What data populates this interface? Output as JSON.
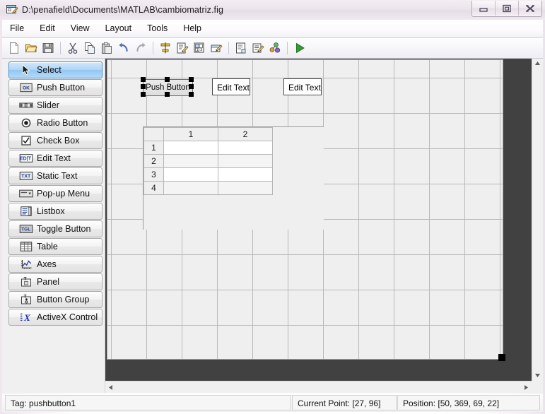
{
  "window": {
    "title": "D:\\penafield\\Documents\\MATLAB\\cambiomatriz.fig",
    "icon": "guide-figure-icon",
    "buttons": {
      "minimize": "minimize-button",
      "restore": "restore-button",
      "close": "close-button"
    }
  },
  "menu": {
    "items": [
      "File",
      "Edit",
      "View",
      "Layout",
      "Tools",
      "Help"
    ]
  },
  "toolbar": {
    "groups": [
      [
        {
          "name": "new-figure-icon",
          "tip": "New"
        },
        {
          "name": "open-file-icon",
          "tip": "Open"
        },
        {
          "name": "save-icon",
          "tip": "Save"
        }
      ],
      [
        {
          "name": "cut-icon",
          "tip": "Cut"
        },
        {
          "name": "copy-icon",
          "tip": "Copy"
        },
        {
          "name": "paste-icon",
          "tip": "Paste"
        },
        {
          "name": "undo-icon",
          "tip": "Undo"
        },
        {
          "name": "redo-icon",
          "tip": "Redo"
        }
      ],
      [
        {
          "name": "align-objects-icon",
          "tip": "Align Objects"
        },
        {
          "name": "menu-editor-icon",
          "tip": "Menu Editor"
        },
        {
          "name": "tab-order-editor-icon",
          "tip": "Tab Order Editor"
        },
        {
          "name": "toolbar-editor-icon",
          "tip": "Toolbar Editor"
        }
      ],
      [
        {
          "name": "m-file-editor-icon",
          "tip": "M-file Editor"
        },
        {
          "name": "property-inspector-icon",
          "tip": "Property Inspector"
        },
        {
          "name": "object-browser-icon",
          "tip": "Object Browser"
        }
      ],
      [
        {
          "name": "run-icon",
          "tip": "Run"
        }
      ]
    ]
  },
  "palette": {
    "items": [
      {
        "label": "Select",
        "icon": "cursor-arrow-icon",
        "selected": true
      },
      {
        "label": "Push Button",
        "icon": "push-button-icon",
        "selected": false
      },
      {
        "label": "Slider",
        "icon": "slider-icon",
        "selected": false
      },
      {
        "label": "Radio Button",
        "icon": "radio-button-icon",
        "selected": false
      },
      {
        "label": "Check Box",
        "icon": "check-box-icon",
        "selected": false
      },
      {
        "label": "Edit Text",
        "icon": "edit-text-icon",
        "selected": false
      },
      {
        "label": "Static Text",
        "icon": "static-text-icon",
        "selected": false
      },
      {
        "label": "Pop-up Menu",
        "icon": "popup-menu-icon",
        "selected": false
      },
      {
        "label": "Listbox",
        "icon": "listbox-icon",
        "selected": false
      },
      {
        "label": "Toggle Button",
        "icon": "toggle-button-icon",
        "selected": false
      },
      {
        "label": "Table",
        "icon": "table-icon",
        "selected": false
      },
      {
        "label": "Axes",
        "icon": "axes-icon",
        "selected": false
      },
      {
        "label": "Panel",
        "icon": "panel-icon",
        "selected": false
      },
      {
        "label": "Button Group",
        "icon": "button-group-icon",
        "selected": false
      },
      {
        "label": "ActiveX Control",
        "icon": "activex-control-icon",
        "selected": false
      }
    ]
  },
  "canvas": {
    "grid_spacing": 50,
    "pushbutton": {
      "label": "Push Button",
      "selected": true
    },
    "edit_text_1": {
      "value": "Edit Text"
    },
    "edit_text_2": {
      "value": "Edit Text"
    },
    "table": {
      "column_headers": [
        "1",
        "2"
      ],
      "row_headers": [
        "1",
        "2",
        "3",
        "4"
      ],
      "rows": [
        [
          "",
          ""
        ],
        [
          "",
          ""
        ],
        [
          "",
          ""
        ],
        [
          "",
          ""
        ]
      ]
    }
  },
  "status": {
    "tag": "Tag: pushbutton1",
    "current_point": "Current Point:  [27, 96]",
    "position": "Position: [50, 369, 69, 22]"
  },
  "colors": {
    "selection_blue": "#aed5f6",
    "canvas_backdrop": "#414141",
    "figure_bg": "#efefef",
    "grid_line": "#b9b9b9",
    "run_green": "#2f9e2f"
  }
}
